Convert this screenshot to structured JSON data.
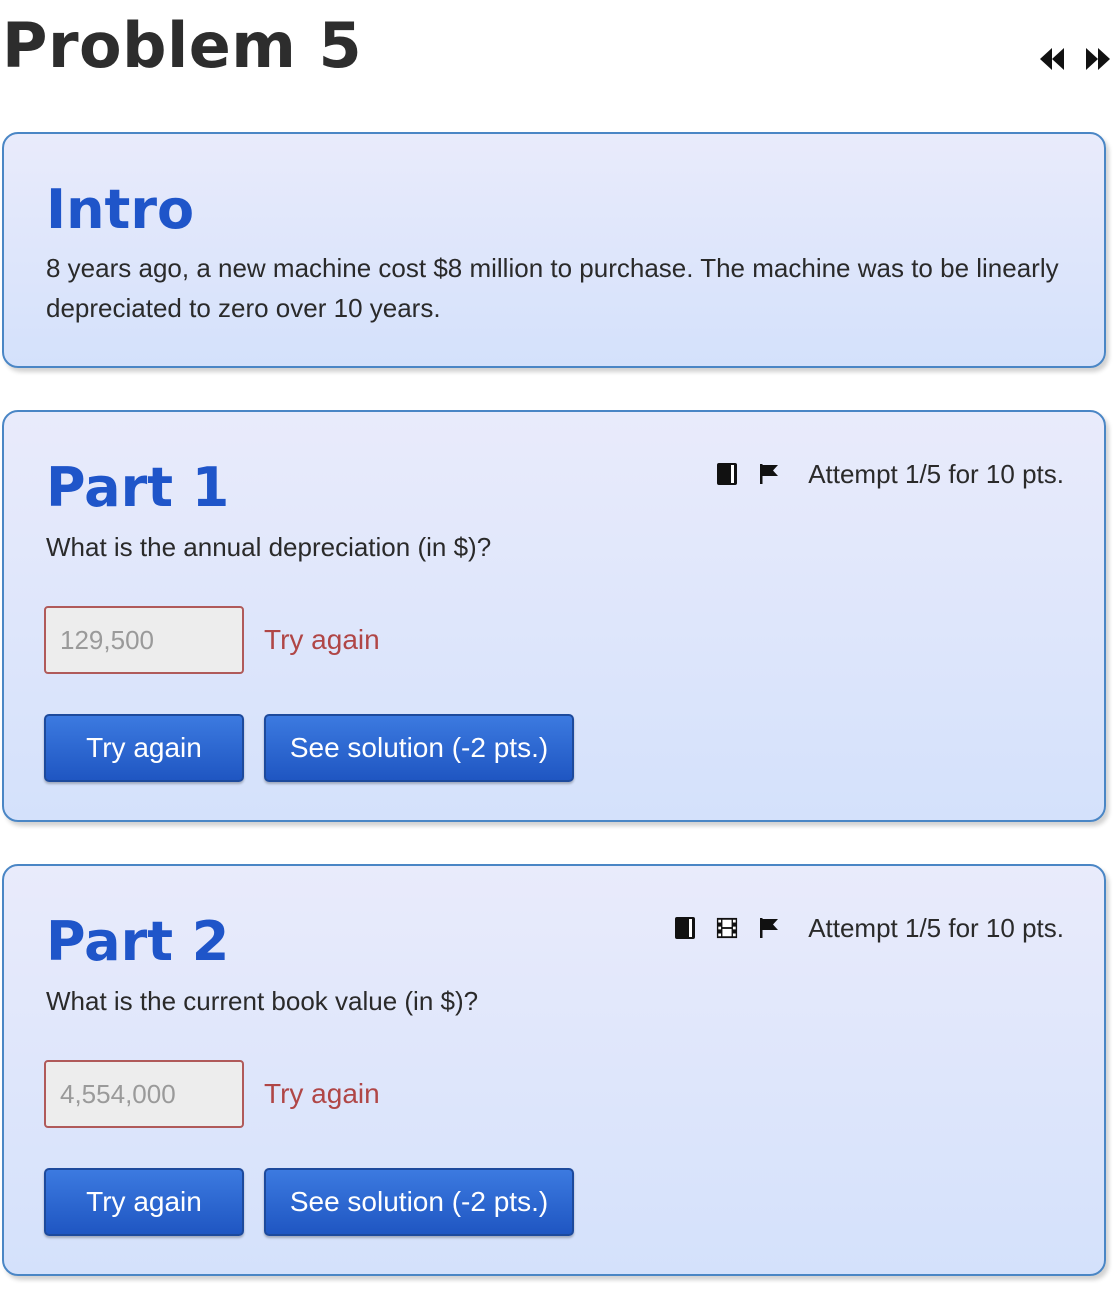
{
  "page": {
    "title": "Problem 5",
    "nav": {
      "prev_icon": "double-chevron-left-icon",
      "next_icon": "double-chevron-right-icon"
    }
  },
  "intro": {
    "heading": "Intro",
    "text": "8 years ago, a new machine cost $8 million to purchase. The machine was to be linearly depreciated to zero over 10 years."
  },
  "parts": [
    {
      "heading": "Part 1",
      "question": "What is the annual depreciation (in $)?",
      "icons": [
        "book-icon",
        "flag-icon"
      ],
      "attempt": "Attempt 1/5 for 10 pts.",
      "answer_value": "129,500",
      "feedback": "Try again",
      "retry_label": "Try again",
      "solution_label": "See solution (-2 pts.)"
    },
    {
      "heading": "Part 2",
      "question": "What is the current book value (in $)?",
      "icons": [
        "book-icon",
        "film-icon",
        "flag-icon"
      ],
      "attempt": "Attempt 1/5 for 10 pts.",
      "answer_value": "4,554,000",
      "feedback": "Try again",
      "retry_label": "Try again",
      "solution_label": "See solution (-2 pts.)"
    }
  ],
  "colors": {
    "heading_blue": "#1f55c9",
    "card_border": "#4a86c5",
    "error_red": "#b04646",
    "button_blue": "#2a66d4"
  }
}
